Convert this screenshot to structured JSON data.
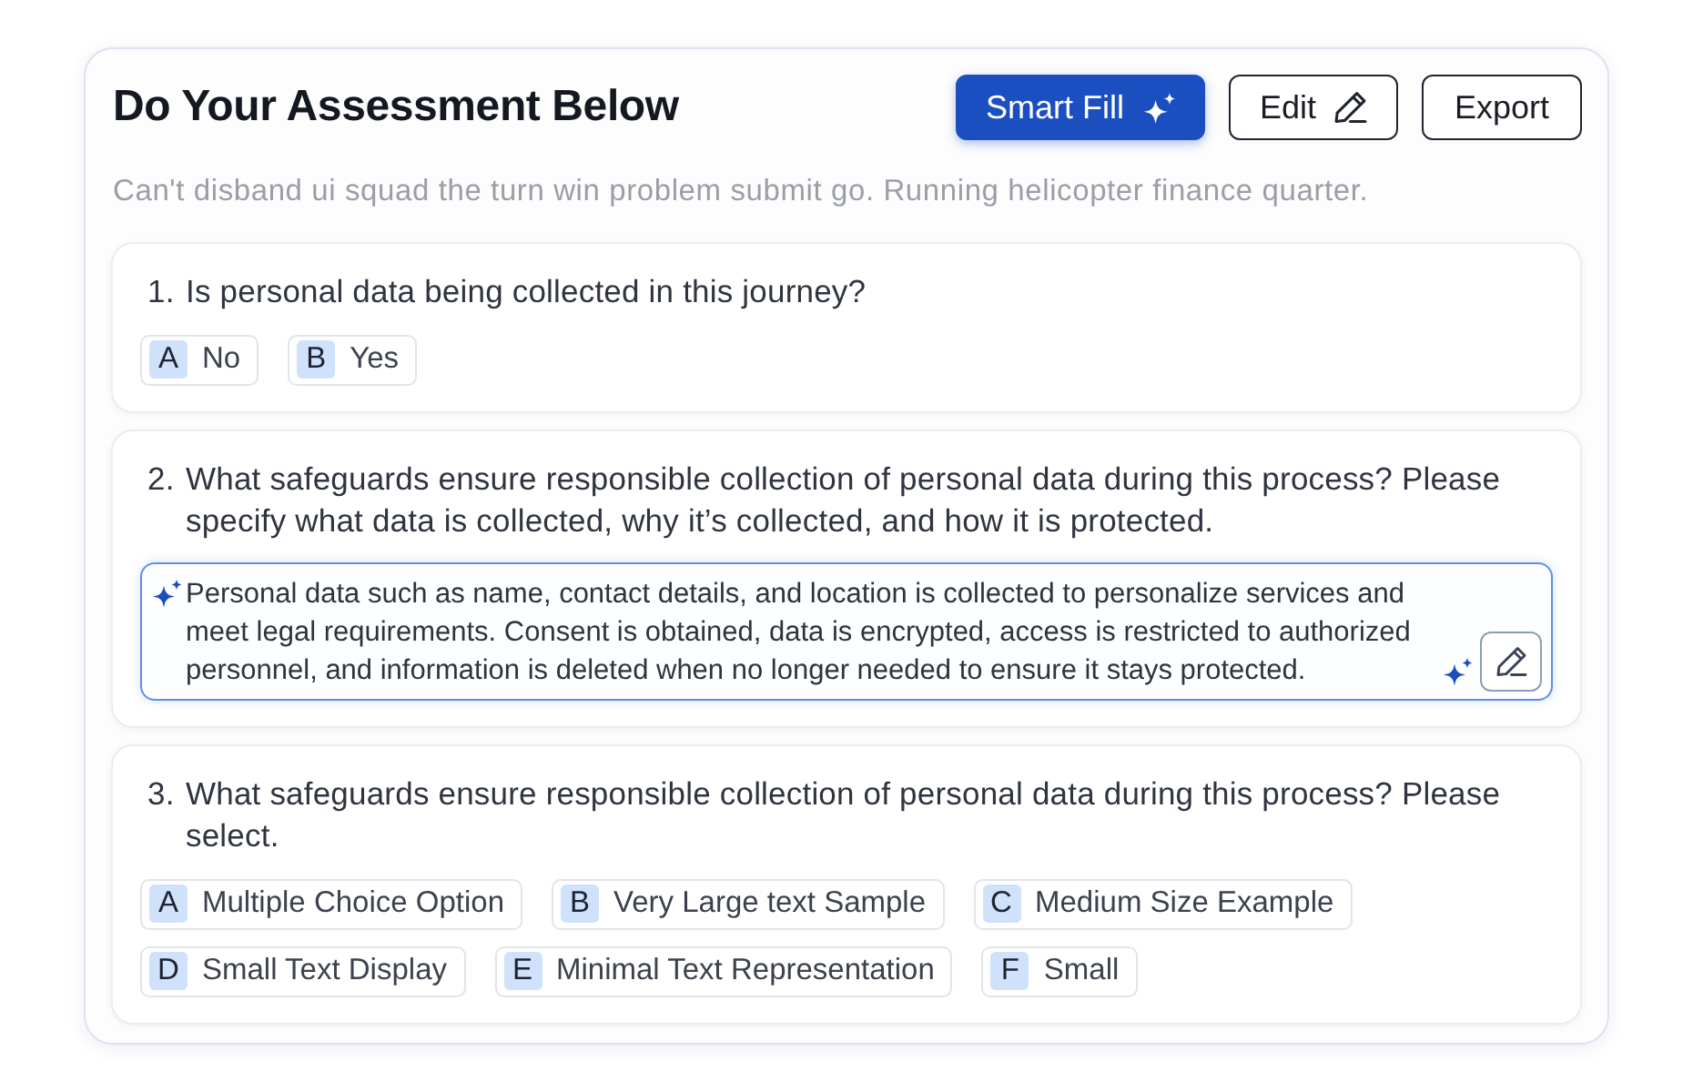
{
  "header": {
    "title": "Do Your Assessment Below",
    "buttons": [
      {
        "label": "Smart Fill",
        "kind": "smart"
      },
      {
        "label": "Edit",
        "kind": "edit"
      },
      {
        "label": "Export",
        "kind": "plain"
      }
    ]
  },
  "subtitle": "Can't disband ui squad the turn win problem submit go. Running helicopter finance quarter.",
  "questions": [
    {
      "number": "1.",
      "text": "Is personal data being collected in this journey?",
      "kind": "choice",
      "options": [
        {
          "letter": "A",
          "label": "No"
        },
        {
          "letter": "B",
          "label": "Yes"
        }
      ]
    },
    {
      "number": "2.",
      "text": "What safeguards ensure responsible collection of personal data during this process? Please specify what data is collected, why it’s collected, and how it is protected.",
      "kind": "text",
      "answer": {
        "text": "Personal data such as name, contact details, and location is collected to personalize services and meet legal requirements. Consent is obtained, data is encrypted, access is restricted to authorized personnel, and information is deleted when no longer needed to ensure it stays protected.",
        "ai_generated": true
      }
    },
    {
      "number": "3.",
      "text": "What safeguards ensure responsible collection of personal data during this process? Please select.",
      "kind": "choice",
      "options": [
        {
          "letter": "A",
          "label": "Multiple Choice Option"
        },
        {
          "letter": "B",
          "label": "Very Large text Sample"
        },
        {
          "letter": "C",
          "label": "Medium Size Example"
        },
        {
          "letter": "D",
          "label": "Small Text Display"
        },
        {
          "letter": "E",
          "label": "Minimal Text Representation"
        },
        {
          "letter": "F",
          "label": "Small"
        }
      ]
    }
  ]
}
